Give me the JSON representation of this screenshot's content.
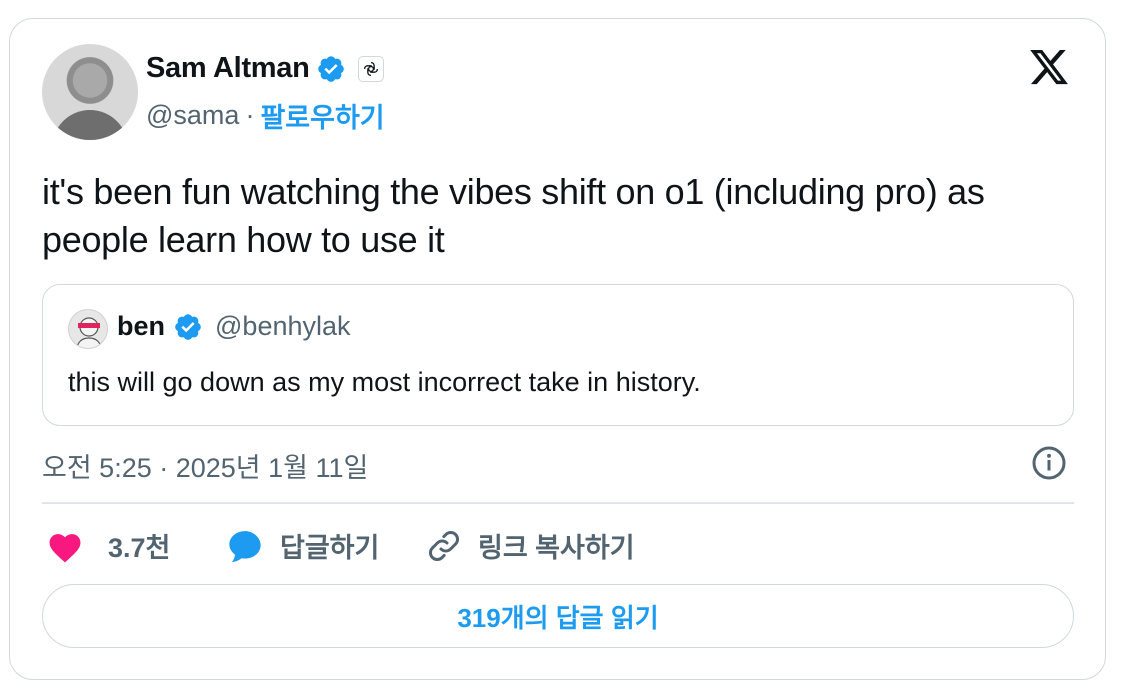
{
  "author": {
    "name": "Sam Altman",
    "handle": "@sama",
    "separator": "·",
    "follow_label": "팔로우하기"
  },
  "tweet": {
    "text": "it's been fun watching the vibes shift on o1 (including pro) as people learn how to use it",
    "timestamp": "오전 5:25 · 2025년 1월 11일"
  },
  "quoted": {
    "name": "ben",
    "handle": "@benhylak",
    "text": "this will go down as my most incorrect take in history."
  },
  "actions": {
    "like_count": "3.7천",
    "reply_label": "답글하기",
    "copy_link_label": "링크 복사하기"
  },
  "read_replies_label": "319개의 답글 읽기",
  "icons": {
    "verified": "verified-badge-icon",
    "affiliate": "openai-affiliate-icon",
    "logo": "x-logo-icon",
    "info": "info-icon",
    "like": "heart-icon",
    "reply": "speech-bubble-icon",
    "link": "link-icon"
  },
  "colors": {
    "accent": "#1d9bf0",
    "like": "#f91880",
    "text": "#0f1419",
    "muted": "#536471",
    "border": "#cfd9de"
  }
}
